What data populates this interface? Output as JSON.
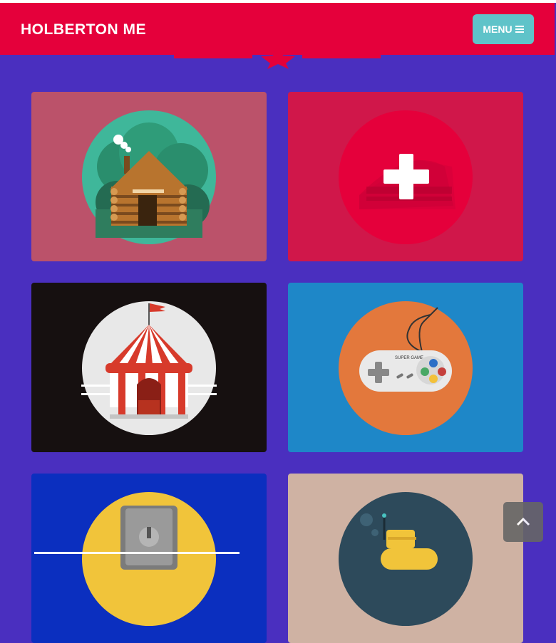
{
  "navbar": {
    "brand": "HOLBERTON ME",
    "menu_label": "MENU"
  },
  "colors": {
    "background": "#4a2fbf",
    "navbar": "#e5003b",
    "menu_button": "#5fc3c9"
  },
  "portfolio": {
    "items": [
      {
        "name": "log-cabin",
        "bg": "#bb526a",
        "circle": "#3fb79a"
      },
      {
        "name": "cake",
        "bg": "#d0174a",
        "circle": "#e5003b"
      },
      {
        "name": "circus-tent",
        "bg": "#161010",
        "circle": "#e8e8e8"
      },
      {
        "name": "game-controller",
        "bg": "#1e87c8",
        "circle": "#e3783c"
      },
      {
        "name": "safe",
        "bg": "#0b2fbf",
        "circle": "#f1c43a"
      },
      {
        "name": "submarine",
        "bg": "#cfb2a3",
        "circle": "#2d4a5b"
      }
    ]
  },
  "icons": {
    "menu": "bars-icon",
    "back_to_top": "chevron-up-icon",
    "add": "plus-icon"
  }
}
